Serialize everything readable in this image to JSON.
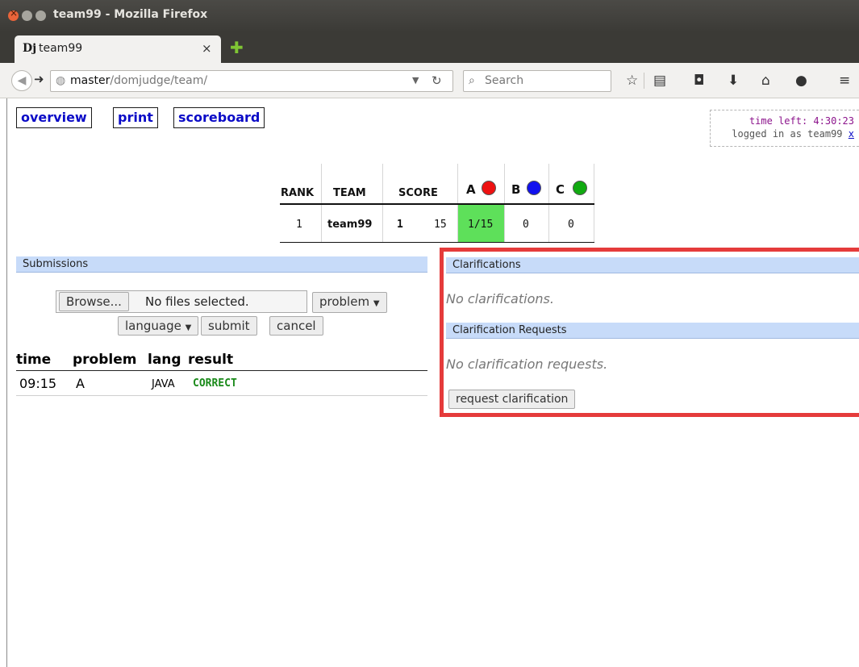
{
  "window": {
    "title": "team99 - Mozilla Firefox"
  },
  "tab": {
    "title": "team99",
    "favicon": "Dj",
    "close": "×",
    "new_tab": "✚"
  },
  "navbar": {
    "url_host": "master",
    "url_path": "/domjudge/team/",
    "search_placeholder": "Search",
    "icons": [
      "bookmark-star-icon",
      "reading-list-icon",
      "pocket-icon",
      "download-icon",
      "home-icon",
      "chat-icon",
      "menu-icon"
    ]
  },
  "page": {
    "nav": {
      "overview": "overview",
      "print": "print",
      "scoreboard": "scoreboard"
    },
    "clock": {
      "time_left": "time left: 4:30:23",
      "logged_in": "logged in as team99",
      "logout": "x"
    },
    "scoreboard": {
      "headers": {
        "rank": "RANK",
        "team": "TEAM",
        "score": "SCORE"
      },
      "problems": [
        {
          "label": "A",
          "color": "#ee1111"
        },
        {
          "label": "B",
          "color": "#1111ee"
        },
        {
          "label": "C",
          "color": "#11aa11"
        }
      ],
      "row": {
        "rank": "1",
        "team": "team99",
        "solved": "1",
        "penalty": "15",
        "a": "1/15",
        "b": "0",
        "c": "0"
      },
      "solved_color": "#5ee05a"
    },
    "submissions": {
      "header": "Submissions",
      "browse_label": "Browse...",
      "file_status": "No files selected.",
      "problem_select": "problem",
      "language_select": "language",
      "submit_label": "submit",
      "cancel_label": "cancel",
      "columns": {
        "time": "time",
        "problem": "problem",
        "lang": "lang",
        "result": "result"
      },
      "rows": [
        {
          "time": "09:15",
          "problem": "A",
          "lang": "JAVA",
          "result": "CORRECT"
        }
      ]
    },
    "clarifications": {
      "header": "Clarifications",
      "empty": "No clarifications.",
      "requests_header": "Clarification Requests",
      "requests_empty": "No clarification requests.",
      "request_button": "request clarification"
    }
  },
  "colors": {
    "link": "#0b0bc7",
    "correct": "#1a8a1a",
    "highlight_border": "#e53b3b"
  }
}
